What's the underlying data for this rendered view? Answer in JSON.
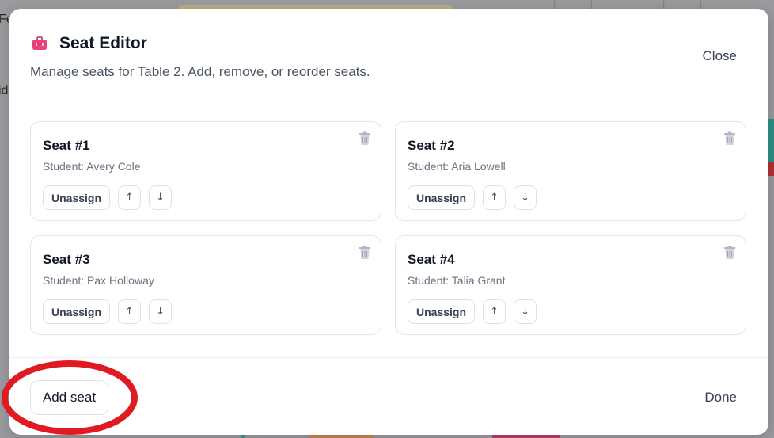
{
  "background": {
    "fragment_top": "Fer",
    "fragment_mid": "id"
  },
  "modal": {
    "title": "Seat Editor",
    "subtitle": "Manage seats for Table 2. Add, remove, or reorder seats.",
    "close_label": "Close",
    "icon": "toolbox-icon"
  },
  "seats": [
    {
      "title": "Seat #1",
      "student": "Student: Avery Cole",
      "unassign_label": "Unassign",
      "up_label": "↑",
      "down_label": "↓"
    },
    {
      "title": "Seat #2",
      "student": "Student: Aria Lowell",
      "unassign_label": "Unassign",
      "up_label": "↑",
      "down_label": "↓"
    },
    {
      "title": "Seat #3",
      "student": "Student: Pax Holloway",
      "unassign_label": "Unassign",
      "up_label": "↑",
      "down_label": "↓"
    },
    {
      "title": "Seat #4",
      "student": "Student: Talia Grant",
      "unassign_label": "Unassign",
      "up_label": "↑",
      "down_label": "↓"
    }
  ],
  "footer": {
    "add_label": "Add seat",
    "done_label": "Done"
  },
  "colors": {
    "accent_icon": "#e8437a",
    "annotation": "#e01a22",
    "trash_icon": "#b8b4c4"
  }
}
